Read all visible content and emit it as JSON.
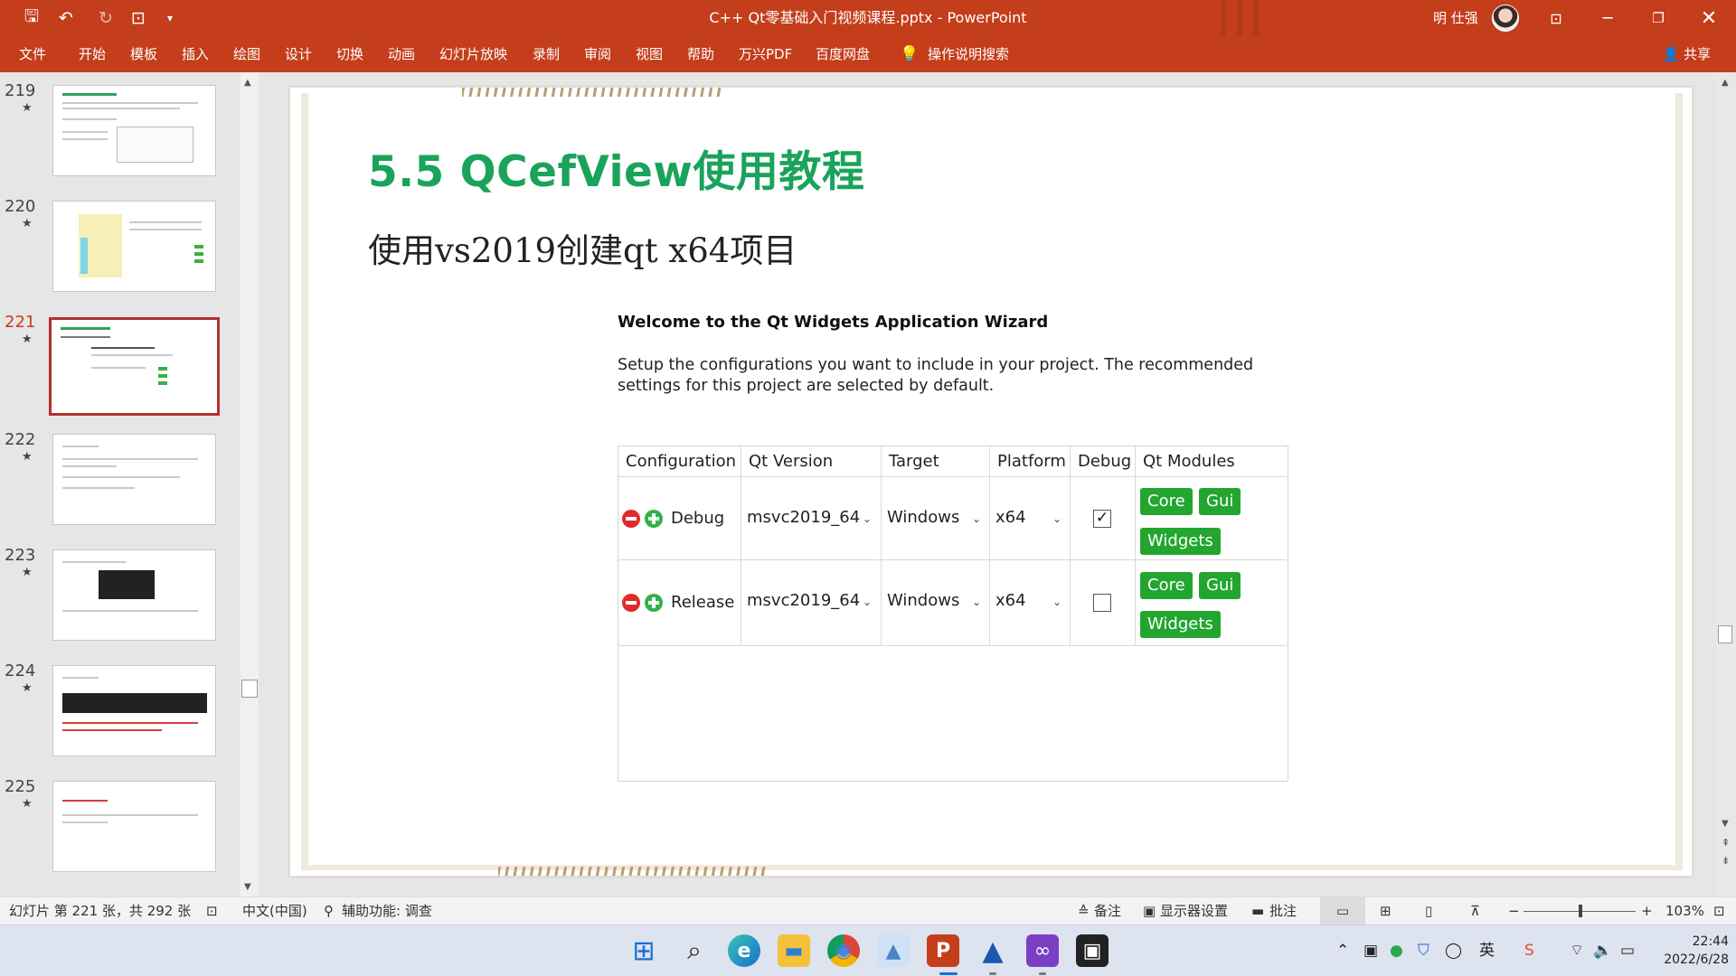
{
  "window": {
    "title": "C++ Qt零基础入门视频课程.pptx  -  PowerPoint",
    "user_name": "明 仕强",
    "accent": "#c43e1c"
  },
  "quick_access": [
    {
      "icon": "save-icon",
      "glyph": "🖫"
    },
    {
      "icon": "undo-icon",
      "glyph": "↶"
    },
    {
      "icon": "redo-icon",
      "glyph": "↻"
    },
    {
      "icon": "present-icon",
      "glyph": "⊡"
    },
    {
      "icon": "customize-icon",
      "glyph": "▾"
    }
  ],
  "ribbon": {
    "tabs": [
      "文件",
      "开始",
      "模板",
      "插入",
      "绘图",
      "设计",
      "切换",
      "动画",
      "幻灯片放映",
      "录制",
      "审阅",
      "视图",
      "帮助",
      "万兴PDF",
      "百度网盘"
    ],
    "search": "操作说明搜索",
    "share": "共享"
  },
  "thumbnails": [
    {
      "number": "219",
      "star": "★",
      "selected": false
    },
    {
      "number": "220",
      "star": "★",
      "selected": false
    },
    {
      "number": "221",
      "star": "★",
      "selected": true
    },
    {
      "number": "222",
      "star": "★",
      "selected": false
    },
    {
      "number": "223",
      "star": "★",
      "selected": false
    },
    {
      "number": "224",
      "star": "★",
      "selected": false
    },
    {
      "number": "225",
      "star": "★",
      "selected": false
    }
  ],
  "slide": {
    "heading": "5.5  QCefView使用教程",
    "subheading": "使用vs2019创建qt x64项目",
    "heading_color": "#1aa35a",
    "wizard": {
      "title": "Welcome to the Qt Widgets Application Wizard",
      "description": "Setup the configurations you want to include in your project. The recommended settings for this project are selected by default.",
      "columns": [
        "Configuration",
        "Qt Version",
        "Target",
        "Platform",
        "Debug",
        "Qt Modules"
      ],
      "rows": [
        {
          "configuration": "Debug",
          "qt_version": "msvc2019_64",
          "target": "Windows",
          "platform": "x64",
          "debug_checked": true,
          "debug_mark": "✓",
          "modules": [
            "Core",
            "Gui",
            "Widgets"
          ]
        },
        {
          "configuration": "Release",
          "qt_version": "msvc2019_64",
          "target": "Windows",
          "platform": "x64",
          "debug_checked": false,
          "debug_mark": "",
          "modules": [
            "Core",
            "Gui",
            "Widgets"
          ]
        }
      ],
      "module_color": "#22a62f"
    }
  },
  "status_bar": {
    "slide_info": "幻灯片 第 221 张，共 292 张",
    "language": "中文(中国)",
    "accessibility": "辅助功能: 调查",
    "notes": "备注",
    "display_settings": "显示器设置",
    "comments": "批注",
    "zoom": "103%",
    "zoom_minus": "−",
    "zoom_plus": "+"
  },
  "taskbar": {
    "apps": [
      {
        "name": "start",
        "glyph": "⊞"
      },
      {
        "name": "search",
        "glyph": "⌕"
      },
      {
        "name": "edge",
        "glyph": "e"
      },
      {
        "name": "file-explorer",
        "glyph": "▬"
      },
      {
        "name": "chrome",
        "glyph": "◉"
      },
      {
        "name": "photos",
        "glyph": "▲"
      },
      {
        "name": "powerpoint",
        "glyph": "P"
      },
      {
        "name": "app-a",
        "glyph": "▲"
      },
      {
        "name": "visual-studio",
        "glyph": "∞"
      },
      {
        "name": "capture",
        "glyph": "▣"
      }
    ],
    "tray_ime": "英",
    "time": "22:44",
    "date": "2022/6/28"
  }
}
